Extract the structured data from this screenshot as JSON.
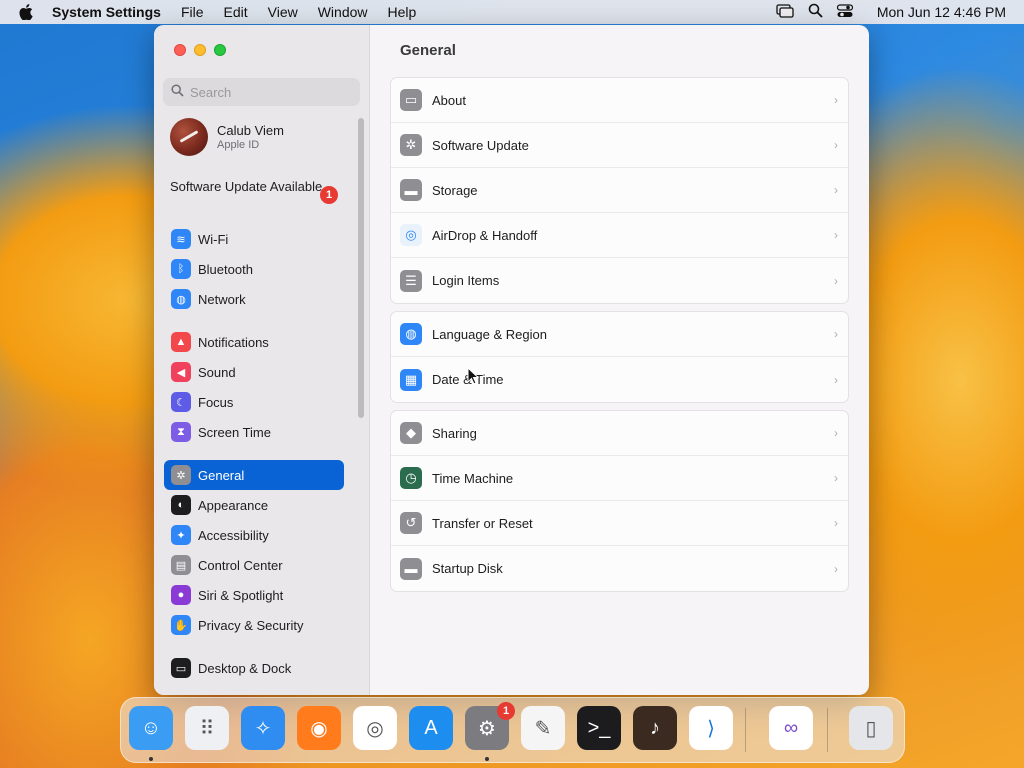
{
  "menubar": {
    "app_name": "System Settings",
    "menus": [
      "File",
      "Edit",
      "View",
      "Window",
      "Help"
    ],
    "clock": "Mon Jun 12  4:46 PM"
  },
  "window": {
    "title": "General",
    "search": {
      "placeholder": "Search"
    },
    "account": {
      "name": "Calub Viem",
      "subtitle": "Apple ID"
    },
    "software_update": {
      "label": "Software Update Available",
      "badge": "1"
    },
    "sidebar": {
      "items": [
        {
          "label": "Wi-Fi",
          "icon": "wifi-icon",
          "color": "#2f86f6",
          "selected": false
        },
        {
          "label": "Bluetooth",
          "icon": "bluetooth-icon",
          "color": "#2f86f6",
          "selected": false
        },
        {
          "label": "Network",
          "icon": "globe-icon",
          "color": "#2f86f6",
          "selected": false
        },
        {
          "label": "Notifications",
          "icon": "bell-icon",
          "color": "#f2484b",
          "selected": false
        },
        {
          "label": "Sound",
          "icon": "speaker-icon",
          "color": "#f0425c",
          "selected": false
        },
        {
          "label": "Focus",
          "icon": "moon-icon",
          "color": "#5e5ce6",
          "selected": false
        },
        {
          "label": "Screen Time",
          "icon": "hourglass-icon",
          "color": "#7d5ce6",
          "selected": false
        },
        {
          "label": "General",
          "icon": "gear-icon",
          "color": "#8e8e93",
          "selected": true
        },
        {
          "label": "Appearance",
          "icon": "appearance-icon",
          "color": "#1d1d1f",
          "selected": false
        },
        {
          "label": "Accessibility",
          "icon": "accessibility-icon",
          "color": "#2f86f6",
          "selected": false
        },
        {
          "label": "Control Center",
          "icon": "control-center-icon",
          "color": "#8e8e93",
          "selected": false
        },
        {
          "label": "Siri & Spotlight",
          "icon": "siri-icon",
          "color": "#8a3bd6",
          "selected": false
        },
        {
          "label": "Privacy & Security",
          "icon": "hand-icon",
          "color": "#2f86f6",
          "selected": false
        },
        {
          "label": "Desktop & Dock",
          "icon": "dock-icon",
          "color": "#1d1d1f",
          "selected": false
        }
      ]
    },
    "groups": [
      [
        {
          "label": "About",
          "icon": "monitor-icon",
          "color": "#8e8e93"
        },
        {
          "label": "Software Update",
          "icon": "gear-icon",
          "color": "#8e8e93"
        },
        {
          "label": "Storage",
          "icon": "drive-icon",
          "color": "#8e8e93"
        },
        {
          "label": "AirDrop & Handoff",
          "icon": "airdrop-icon",
          "color": "#e9f1fb"
        },
        {
          "label": "Login Items",
          "icon": "list-icon",
          "color": "#8e8e93"
        }
      ],
      [
        {
          "label": "Language & Region",
          "icon": "globe-icon",
          "color": "#2f86f6"
        },
        {
          "label": "Date & Time",
          "icon": "calendar-clock-icon",
          "color": "#2f86f6"
        }
      ],
      [
        {
          "label": "Sharing",
          "icon": "sharing-icon",
          "color": "#8e8e93"
        },
        {
          "label": "Time Machine",
          "icon": "time-machine-icon",
          "color": "#2b6b4e"
        },
        {
          "label": "Transfer or Reset",
          "icon": "reset-icon",
          "color": "#8e8e93"
        },
        {
          "label": "Startup Disk",
          "icon": "disk-icon",
          "color": "#8e8e93"
        }
      ]
    ]
  },
  "dock": {
    "apps": [
      {
        "name": "Finder",
        "icon": "finder-icon",
        "color": "#3a9cf2",
        "running": true
      },
      {
        "name": "Launchpad",
        "icon": "launchpad-icon",
        "color": "#eef0f3",
        "running": false
      },
      {
        "name": "Safari",
        "icon": "safari-icon",
        "color": "#2f8cf0",
        "running": false
      },
      {
        "name": "Firefox",
        "icon": "firefox-icon",
        "color": "#ff7b1c",
        "running": false
      },
      {
        "name": "Chrome",
        "icon": "chrome-icon",
        "color": "#ffffff",
        "running": false
      },
      {
        "name": "App Store",
        "icon": "app-store-icon",
        "color": "#1e8df0",
        "running": false
      },
      {
        "name": "System Settings",
        "icon": "settings-icon",
        "color": "#7b7b80",
        "running": true,
        "badge": "1"
      },
      {
        "name": "TextEdit",
        "icon": "textedit-icon",
        "color": "#f5f5f5",
        "running": false
      },
      {
        "name": "Terminal",
        "icon": "terminal-icon",
        "color": "#1c1c1e",
        "running": false
      },
      {
        "name": "GarageBand",
        "icon": "guitar-icon",
        "color": "#3a2a20",
        "running": false
      },
      {
        "name": "Visual Studio Code",
        "icon": "vscode-icon",
        "color": "#ffffff",
        "running": false
      },
      {
        "name": "Visual Studio",
        "icon": "visual-studio-icon",
        "color": "#ffffff",
        "running": false
      },
      {
        "name": "Trash",
        "icon": "trash-icon",
        "color": "#e4e6e9",
        "running": false
      }
    ]
  }
}
